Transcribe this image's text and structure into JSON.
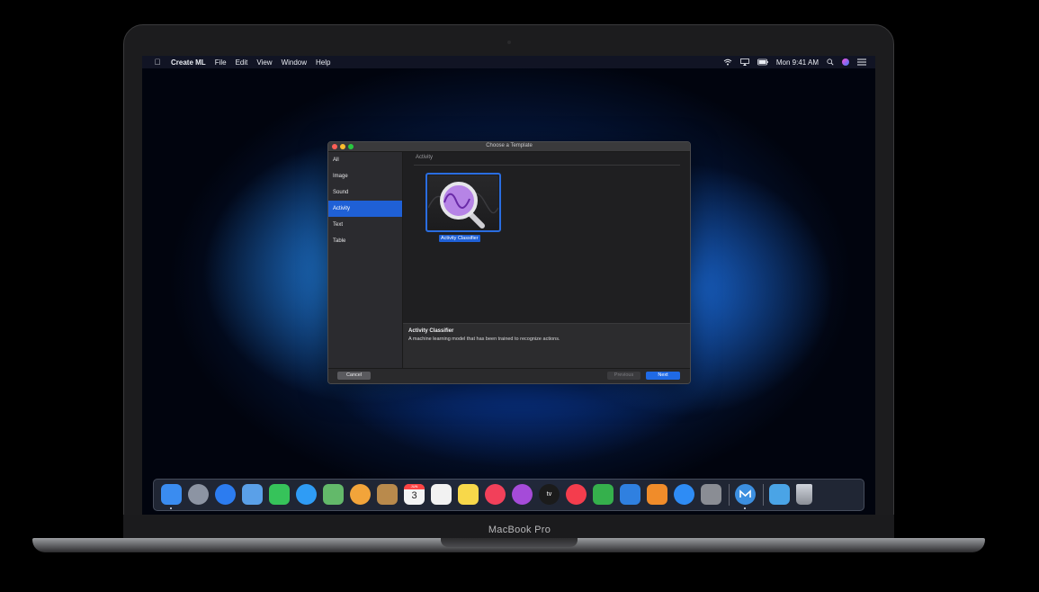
{
  "device": {
    "brand_label": "MacBook Pro"
  },
  "menubar": {
    "app_name": "Create ML",
    "menus": [
      "File",
      "Edit",
      "View",
      "Window",
      "Help"
    ],
    "clock": "Mon 9:41 AM",
    "icons": [
      "apple-icon",
      "wifi-icon",
      "airplay-icon",
      "battery-icon",
      "spotlight-search-icon",
      "siri-icon",
      "control-list-icon"
    ]
  },
  "dialog": {
    "title": "Choose a Template",
    "sidebar": [
      "All",
      "Image",
      "Sound",
      "Activity",
      "Text",
      "Table"
    ],
    "selected_category": "Activity",
    "section_title": "Activity",
    "templates": [
      {
        "label": "Activity Classifier",
        "icon": "activity-classifier-icon",
        "selected": true
      }
    ],
    "description": {
      "title": "Activity Classifier",
      "text": "A machine learning model that has been trained to recognize actions."
    },
    "buttons": {
      "cancel": "Cancel",
      "previous": "Previous",
      "next": "Next"
    }
  },
  "dock": {
    "apps": [
      {
        "name": "finder",
        "color": "#3a8cf0"
      },
      {
        "name": "launchpad",
        "color": "#8c94a3"
      },
      {
        "name": "safari",
        "color": "#2c7cf0"
      },
      {
        "name": "mail",
        "color": "#5aa0e8"
      },
      {
        "name": "facetime",
        "color": "#36c35a"
      },
      {
        "name": "messages",
        "color": "#2f9cf5"
      },
      {
        "name": "maps",
        "color": "#63b96a"
      },
      {
        "name": "photos",
        "color": "#f2a43a"
      },
      {
        "name": "contacts",
        "color": "#b98a4c"
      },
      {
        "name": "calendar",
        "color": "#f4f4f4"
      },
      {
        "name": "reminders",
        "color": "#f2f2f2"
      },
      {
        "name": "notes",
        "color": "#f8d84a"
      },
      {
        "name": "music",
        "color": "#f2405a"
      },
      {
        "name": "podcasts",
        "color": "#a54bd9"
      },
      {
        "name": "tv",
        "color": "#1b1b1b"
      },
      {
        "name": "news",
        "color": "#f43d4d"
      },
      {
        "name": "numbers",
        "color": "#35b04c"
      },
      {
        "name": "keynote",
        "color": "#2f80e0"
      },
      {
        "name": "pages",
        "color": "#f08c2a"
      },
      {
        "name": "app-store",
        "color": "#2e8cf5"
      },
      {
        "name": "system-preferences",
        "color": "#8a8d94"
      },
      {
        "name": "create-ml",
        "color": "#3c8fe0"
      },
      {
        "name": "downloads",
        "color": "#4aa4e6"
      },
      {
        "name": "trash",
        "color": "#b8bcc4"
      }
    ],
    "calendar_day": "3",
    "calendar_month": "JUN",
    "tv_label": "tv"
  },
  "colors": {
    "accent": "#1f60d6",
    "window_bg": "#232325",
    "sidebar_bg": "#2b2b2f"
  }
}
